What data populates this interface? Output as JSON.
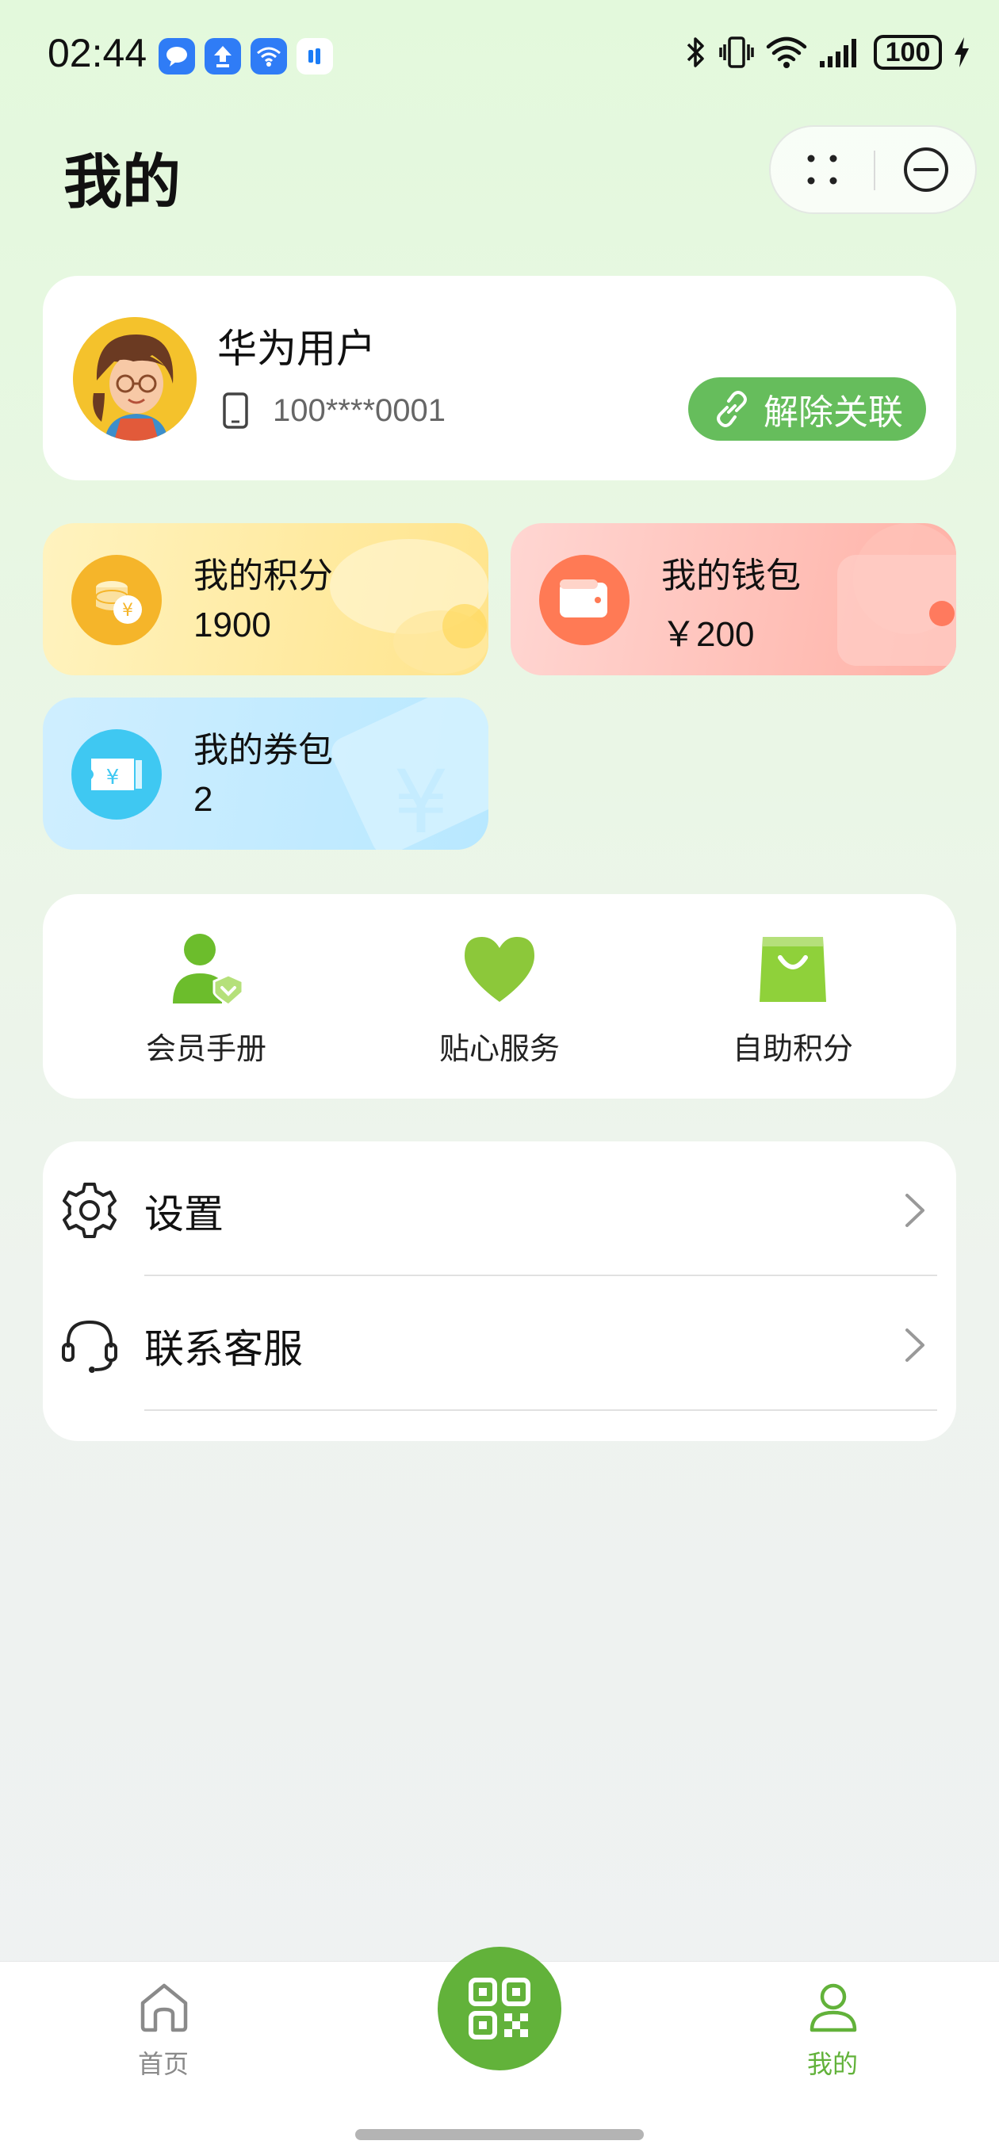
{
  "status_bar": {
    "time": "02:44",
    "battery": "100",
    "icons": [
      "message-icon",
      "upload-icon",
      "wifi-hotspot-icon",
      "app-icon",
      "bluetooth-icon",
      "vibrate-icon",
      "wifi-icon",
      "signal-icon",
      "battery-icon",
      "charging-icon"
    ]
  },
  "header": {
    "title": "我的"
  },
  "profile": {
    "username": "华为用户",
    "phone": "100****0001",
    "unbind_label": "解除关联"
  },
  "assets": {
    "points": {
      "label": "我的积分",
      "value": "1900"
    },
    "wallet": {
      "label": "我的钱包",
      "value": "￥200"
    },
    "coupons": {
      "label": "我的券包",
      "value": "2"
    }
  },
  "shortcuts": [
    {
      "label": "会员手册"
    },
    {
      "label": "贴心服务"
    },
    {
      "label": "自助积分"
    }
  ],
  "menu": [
    {
      "label": "设置"
    },
    {
      "label": "联系客服"
    }
  ],
  "tab_bar": {
    "home": "首页",
    "mine": "我的"
  },
  "colors": {
    "accent": "#62b23a",
    "tab_active": "#62b23a",
    "tab_inactive": "#8a8a8a"
  }
}
